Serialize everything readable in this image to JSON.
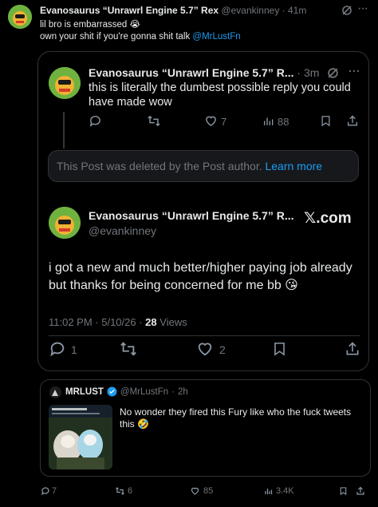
{
  "post": {
    "display_name": "Evanosaurus “Unrawrl Engine 5.7” Rex",
    "handle": "@evankinney",
    "sep": "·",
    "time": "41m",
    "line1": "lil bro is embarrassed 😭",
    "line2_text": "own your shit if you're gonna shit talk ",
    "line2_mention": "@MrLustFn",
    "menu": "···"
  },
  "quoted_reply": {
    "display_name": "Evanosaurus “Unrawrl Engine 5.7” R...",
    "time": "3m",
    "menu": "···",
    "text": "this is literally the dumbest possible reply you could have made wow",
    "likes": "7",
    "views": "88"
  },
  "deleted_notice": {
    "text": "This Post was deleted by the Post author.",
    "link": "Learn more"
  },
  "main_tweet": {
    "display_name": "Evanosaurus “Unrawrl Engine 5.7” R...",
    "handle": "@evankinney",
    "brand": "𝕏.com",
    "text": "i got a new and much better/higher paying job already but thanks for being concerned for me bb 😘",
    "timestamp": "11:02 PM · 5/10/26 ·",
    "views_count": "28",
    "views_label": "Views",
    "replies": "1",
    "likes": "2"
  },
  "quote_card": {
    "display_name": "MRLUST",
    "handle": "@MrLustFn",
    "sep": "·",
    "time": "2h",
    "text": "No wonder they fired this Fury like who the fuck tweets this 🤣"
  },
  "footer": {
    "replies": "7",
    "reposts": "6",
    "likes": "85",
    "views": "3.4K"
  },
  "colors": {
    "background": "#000000",
    "text": "#e7e9ea",
    "muted": "#71767b",
    "accent": "#1d9bf0",
    "border": "#2f3336",
    "verified": "#1d9bf0"
  }
}
